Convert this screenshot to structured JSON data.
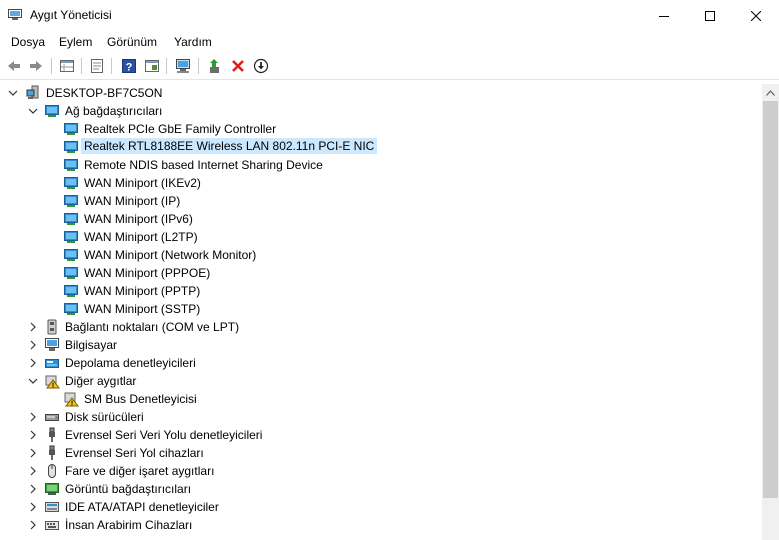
{
  "window": {
    "title": "Aygıt Yöneticisi"
  },
  "menu": [
    {
      "label": "Dosya"
    },
    {
      "label": "Eylem"
    },
    {
      "label": "Görünüm"
    },
    {
      "label": "Yardım"
    }
  ],
  "toolbar": {
    "icons": [
      "back-arrow-icon",
      "forward-arrow-icon",
      "properties-grid-icon",
      "properties-icon",
      "help-icon",
      "show-hidden-icon",
      "scan-hardware-icon",
      "update-driver-icon",
      "uninstall-x-icon",
      "disable-device-icon"
    ]
  },
  "tree": {
    "root": "DESKTOP-BF7C5ON",
    "network_category": "Ağ bağdaştırıcıları",
    "network_children": [
      "Realtek PCIe GbE Family Controller",
      "Realtek RTL8188EE Wireless LAN 802.11n PCI-E NIC",
      "Remote NDIS based Internet Sharing Device",
      "WAN Miniport (IKEv2)",
      "WAN Miniport (IP)",
      "WAN Miniport (IPv6)",
      "WAN Miniport (L2TP)",
      "WAN Miniport (Network Monitor)",
      "WAN Miniport (PPPOE)",
      "WAN Miniport (PPTP)",
      "WAN Miniport (SSTP)"
    ],
    "selected_index": 1,
    "categories_a": [
      "Bağlantı noktaları (COM ve LPT)",
      "Bilgisayar",
      "Depolama denetleyicileri"
    ],
    "other_category": "Diğer aygıtlar",
    "other_children": [
      "SM Bus Denetleyicisi"
    ],
    "categories_b": [
      "Disk sürücüleri",
      "Evrensel Seri Veri Yolu denetleyicileri",
      "Evrensel Seri Yol cihazları",
      "Fare ve diğer işaret aygıtları",
      "Görüntü bağdaştırıcıları",
      "IDE ATA/ATAPI denetleyiciler",
      "İnsan Arabirim Cihazları"
    ]
  },
  "colors": {
    "selection": "#cce8ff",
    "network_icon": "#2b8fd6",
    "error_red": "#e0201b"
  }
}
